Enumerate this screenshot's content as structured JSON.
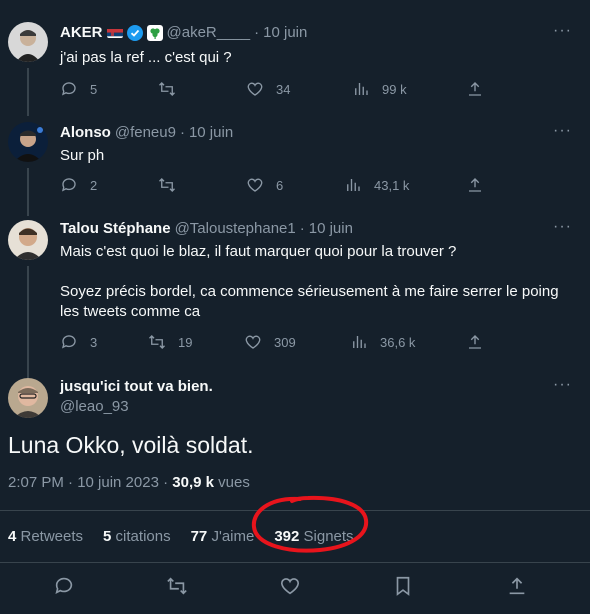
{
  "replies": [
    {
      "name": "AKER",
      "handle": "@akeR____",
      "date": "10 juin",
      "text": "j'ai pas la ref ... c'est qui ?",
      "reply_count": "5",
      "retweet_count": "",
      "like_count": "34",
      "view_count": "99 k"
    },
    {
      "name": "Alonso",
      "handle": "@feneu9",
      "date": "10 juin",
      "text": "Sur ph",
      "reply_count": "2",
      "retweet_count": "",
      "like_count": "6",
      "view_count": "43,1 k"
    },
    {
      "name": "Talou Stéphane",
      "handle": "@Taloustephane1",
      "date": "10 juin",
      "text_line1": "Mais c'est quoi le blaz, il faut marquer quoi pour la trouver ?",
      "text_line2": "Soyez précis bordel, ca commence sérieusement à me faire serrer le poing",
      "text_line3": "les tweets comme ca",
      "reply_count": "3",
      "retweet_count": "19",
      "like_count": "309",
      "view_count": "36,6 k"
    }
  ],
  "main_tweet": {
    "name": "jusqu'ici tout va bien.",
    "handle": "@leao_93",
    "text": "Luna Okko, voilà soldat.",
    "time": "2:07 PM · 10 juin 2023 · ",
    "views_count": "30,9 k",
    "views_label": " vues",
    "retweets_count": "4",
    "retweets_label": " Retweets",
    "citations_count": "5",
    "citations_label": " citations",
    "likes_count": "77",
    "likes_label": " J'aime",
    "bookmarks_count": "392",
    "bookmarks_label": " Signets"
  },
  "symbols": {
    "dot": "·",
    "more": "···"
  },
  "colors": {
    "background": "#15202b",
    "text": "#f7f9f9",
    "muted": "#8b98a5",
    "border": "#38444d",
    "verified": "#1d9bf0",
    "annotation": "#e8141c"
  }
}
